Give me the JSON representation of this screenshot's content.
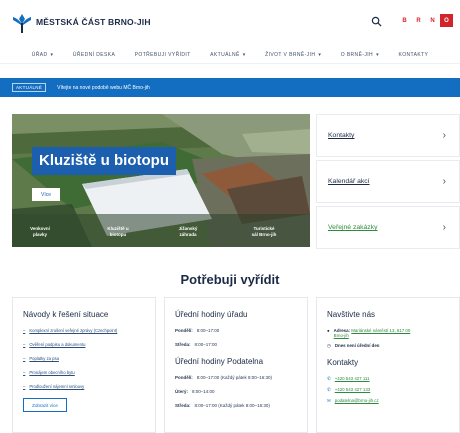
{
  "header": {
    "site_title": "MĚSTSKÁ ČÁST BRNO-JIH",
    "languages": [
      "B",
      "R",
      "N",
      "O"
    ]
  },
  "nav": {
    "items": [
      {
        "label": "ÚŘAD",
        "has_dropdown": true
      },
      {
        "label": "ÚŘEDNÍ DESKA",
        "has_dropdown": false
      },
      {
        "label": "POTŘEBUJI VYŘÍDIT",
        "has_dropdown": false
      },
      {
        "label": "AKTUÁLNĚ",
        "has_dropdown": true
      },
      {
        "label": "ŽIVOT V BRNĚ-JIH",
        "has_dropdown": true
      },
      {
        "label": "O BRNĚ-JIH",
        "has_dropdown": true
      },
      {
        "label": "KONTAKTY",
        "has_dropdown": false
      }
    ]
  },
  "banner": {
    "badge": "AKTUÁLNĚ",
    "text": "Vítejte na nové podobě webu MČ Brno-jih"
  },
  "hero": {
    "title": "Kluziště u biotopu",
    "button": "Více",
    "thumbs": [
      "Venkovní\nplavky",
      "Kluziště u\nbiotopu",
      "Jižanský\nzáhrada",
      "Turistické\nsál Brno-jih"
    ]
  },
  "side_links": [
    {
      "label": "Kontakty",
      "accent": false
    },
    {
      "label": "Kalendář akcí",
      "accent": false
    },
    {
      "label": "Veřejné zakázky",
      "accent": true
    }
  ],
  "section": {
    "title": "Potřebuji vyřídit"
  },
  "guides": {
    "title": "Návody k řešení situace",
    "items": [
      "Komplexní zrušení veřejné zprávy (Czechpoint)",
      "Ověření podpisu a dokumentu",
      "Poplatky za psa",
      "Pronájem obecního bytu",
      "Prodloužení nájemní smlouvy"
    ],
    "more_button": "Zobrazit více"
  },
  "office_hours": {
    "title": "Úřední hodiny úřadu",
    "rows": [
      {
        "day": "Pondělí:",
        "time": "8:00–17:00"
      },
      {
        "day": "Středa:",
        "time": "8:00–17:00"
      }
    ]
  },
  "registry_hours": {
    "title": "Úřední hodiny Podatelna",
    "rows": [
      {
        "day": "Pondělí:",
        "time": "8:00–17:00 (Každý pátek 8:00–16:30)"
      },
      {
        "day": "Úterý:",
        "time": "8:00–14:00"
      },
      {
        "day": "Středa:",
        "time": "8:00–17:00 (Každý pátek 8:00–16:30)"
      }
    ]
  },
  "visit": {
    "title": "Navštivte nás",
    "address_label": "Adresa:",
    "address_value": "Mariánské náměstí 13, 617 00",
    "address_city": "Brno-jih",
    "hours_note": "Dnes není úřední den",
    "contacts_title": "Kontakty",
    "phone1": "+420 543 427 111",
    "phone2": "+420 543 427 133",
    "email": "podatelna@brno-jih.cz"
  },
  "colors": {
    "brand_blue": "#136dc0",
    "title_blue": "#1c5fae",
    "accent_red": "#d1252b",
    "accent_green": "#2e8a3c"
  }
}
